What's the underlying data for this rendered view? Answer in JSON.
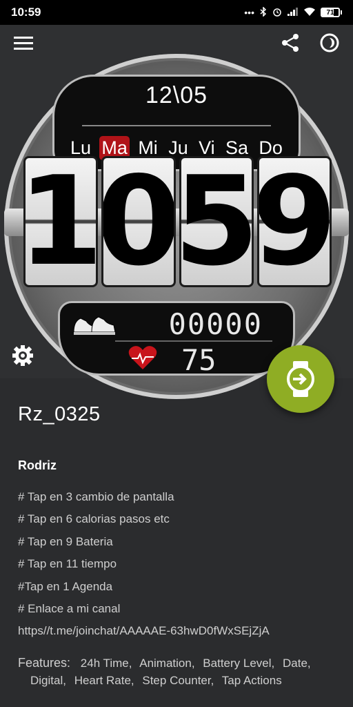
{
  "status_bar": {
    "time": "10:59",
    "icons": [
      "dots-icon",
      "bluetooth-icon",
      "alarm-icon",
      "signal-icon",
      "wifi-icon",
      "battery-icon"
    ],
    "battery_percent": 71,
    "battery_label": "71"
  },
  "header": {
    "menu_icon": "menu-icon",
    "share_icon": "share-icon",
    "theme_icon": "theme-icon"
  },
  "watch_face": {
    "date": "12\\05",
    "days": [
      "Lu",
      "Ma",
      "Mi",
      "Ju",
      "Vi",
      "Sa",
      "Do"
    ],
    "active_day": "Ma",
    "time_digits": [
      "1",
      "0",
      "5",
      "9"
    ],
    "steps": "00000",
    "heart_rate": "75"
  },
  "settings_icon": "gear-icon",
  "fab_icon": "watch-install-icon",
  "details": {
    "title": "Rz_0325",
    "author": "Rodriz",
    "description_lines": [
      "# Tap en 3 cambio de pantalla",
      "# Tap en 6 calorias pasos etc",
      "# Tap en 9 Bateria",
      "# Tap en 11 tiempo",
      "#Tap en 1 Agenda",
      "# Enlace a mi canal",
      "https//t.me/joinchat/AAAAAE-63hwD0fWxSEjZjA"
    ],
    "features_label": "Features:",
    "features": [
      "24h Time,",
      "Animation,",
      "Battery Level,",
      "Date,",
      "Digital,",
      "Heart Rate,",
      "Step Counter,",
      "Tap Actions"
    ]
  },
  "colors": {
    "accent_green": "#8fad24",
    "active_day_red": "#b01318",
    "background": "#2b2c2e"
  }
}
